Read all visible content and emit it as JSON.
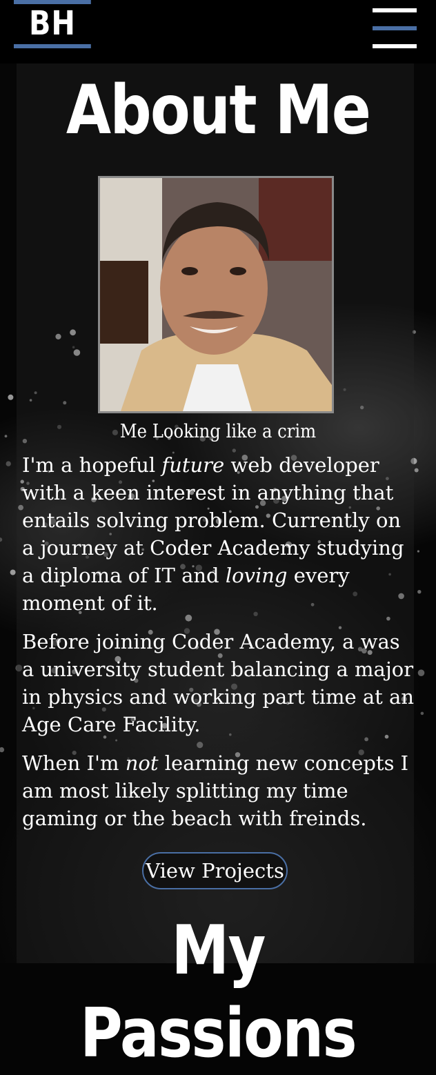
{
  "header": {
    "logo_text": "BH",
    "menu_icon": "hamburger-menu-icon",
    "accent_color": "#4a6fa5"
  },
  "about": {
    "title": "About Me",
    "photo_caption": "Me Looking like a crim",
    "paragraph1": {
      "before_future": "I'm a hopeful ",
      "future": "future",
      "after_future": " web developer with a keen interest in anything that entails solving problem. Currently on a journey at Coder Academy studying a diploma of IT and ",
      "loving": "loving",
      "after_loving": " every moment of it."
    },
    "paragraph2": "Before joining Coder Academy, a was a university student balancing a major in physics and working part time at an Age Care Facility.",
    "paragraph3": {
      "before_not": "When I'm ",
      "not": "not",
      "after_not": " learning new concepts I am most likely splitting my time gaming or the beach with freinds."
    },
    "view_projects_label": "View Projects"
  },
  "passions": {
    "title": "My Passions"
  }
}
